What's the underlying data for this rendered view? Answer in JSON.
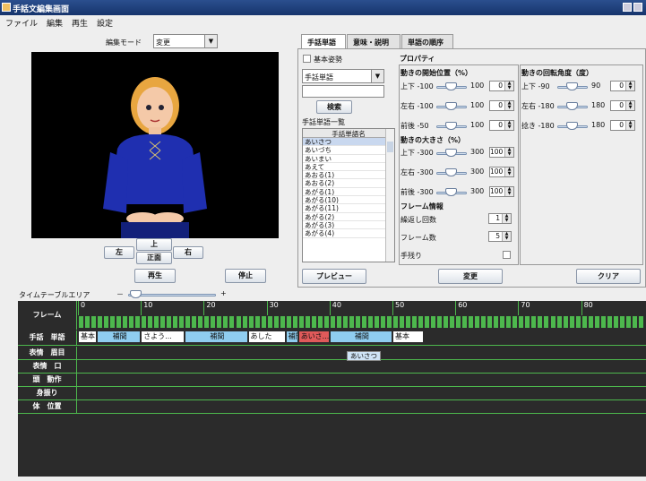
{
  "window": {
    "title": "手話文編集画面"
  },
  "menu": [
    "ファイル",
    "編集",
    "再生",
    "設定"
  ],
  "edit_mode": {
    "label": "編集モード",
    "value": "変更"
  },
  "view_buttons": {
    "left": "左",
    "up": "上",
    "front": "正面",
    "right": "右"
  },
  "playback": {
    "play": "再生",
    "stop": "停止"
  },
  "tabs": [
    "手話単語",
    "意味・説明",
    "単語の順序"
  ],
  "word_panel": {
    "basic_pose": "基本姿勢",
    "word_combo": "手話単語",
    "search": "検索",
    "list_title": "手話単語一覧",
    "column_header": "手話単語名",
    "items": [
      "あいさつ",
      "あいづち",
      "あいまい",
      "あえて",
      "あおる(1)",
      "あおる(2)",
      "あがる(1)",
      "あがる(10)",
      "あがる(11)",
      "あがる(2)",
      "あがる(3)",
      "あがる(4)"
    ]
  },
  "properties": {
    "title": "プロパティ",
    "position": {
      "title": "動きの開始位置（%）",
      "rows": [
        {
          "axis": "上下",
          "min": "-100",
          "max": "100",
          "value": "0"
        },
        {
          "axis": "左右",
          "min": "-100",
          "max": "100",
          "value": "0"
        },
        {
          "axis": "前後",
          "min": "-50",
          "max": "100",
          "value": "0"
        }
      ]
    },
    "rotation": {
      "title": "動きの回転角度（度）",
      "rows": [
        {
          "axis": "上下",
          "min": "-90",
          "max": "90",
          "value": "0"
        },
        {
          "axis": "左右",
          "min": "-180",
          "max": "180",
          "value": "0"
        },
        {
          "axis": "捻き",
          "min": "-180",
          "max": "180",
          "value": "0"
        }
      ]
    },
    "size": {
      "title": "動きの大きさ（%）",
      "rows": [
        {
          "axis": "上下",
          "min": "-300",
          "max": "300",
          "value": "100"
        },
        {
          "axis": "左右",
          "min": "-300",
          "max": "300",
          "value": "100"
        },
        {
          "axis": "前後",
          "min": "-300",
          "max": "300",
          "value": "100"
        }
      ]
    },
    "frame": {
      "title": "フレーム情報",
      "repeat_label": "繰返し回数",
      "repeat_value": "1",
      "frames_label": "フレーム数",
      "frames_value": "5",
      "hold_label": "手残り"
    }
  },
  "actions": {
    "preview": "プレビュー",
    "change": "変更",
    "clear": "クリア"
  },
  "timeline": {
    "area_label": "タイムテーブルエリア",
    "zoom_minus": "－",
    "zoom_plus": "+",
    "frame_label": "フレーム",
    "ticks": [
      "0",
      "10",
      "20",
      "30",
      "40",
      "50",
      "60",
      "70",
      "80"
    ],
    "rows": [
      "手話　単語",
      "表情　眉目",
      "表情　口",
      "頭　動作",
      "身振り",
      "体　位置"
    ],
    "word_cells": [
      "基本",
      "補間",
      "さよう...",
      "補間",
      "あした",
      "補間",
      "あいさ...",
      "補間",
      "基本"
    ],
    "tooltip": "あいさつ"
  },
  "colors": {
    "title_bar": "#1e3f7c",
    "timeline_bg": "#2b2b2b",
    "grid_green": "#4db84d",
    "word_cell": "#8fcdf0",
    "selected_cell": "#e05a5a"
  }
}
